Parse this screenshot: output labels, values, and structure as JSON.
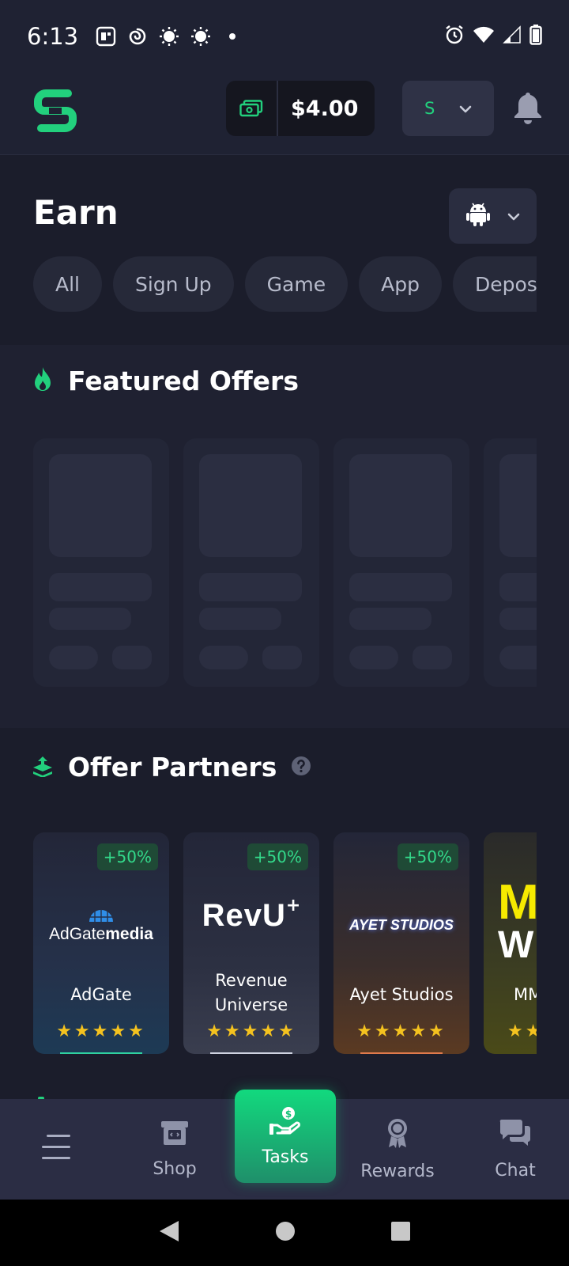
{
  "status_bar": {
    "time": "6:13"
  },
  "header": {
    "balance": "$4.00",
    "user_initial": "S"
  },
  "earn": {
    "title": "Earn",
    "filters": [
      "All",
      "Sign Up",
      "Game",
      "App",
      "Deposi"
    ]
  },
  "featured": {
    "title": "Featured Offers"
  },
  "partners": {
    "title": "Offer Partners",
    "items": [
      {
        "name": "AdGate",
        "badge": "+50%",
        "logo_text_a": "AdGate",
        "logo_text_b": "media",
        "rating": "★★★★★"
      },
      {
        "name": "Revenue Universe",
        "badge": "+50%",
        "logo_text": "RevU",
        "rating": "★★★★★"
      },
      {
        "name": "Ayet Studios",
        "badge": "+50%",
        "logo_text": "AYET STUDIOS",
        "rating": "★★★★★"
      },
      {
        "name": "MM",
        "badge": "",
        "logo_text_a": "M",
        "logo_text_b": "W",
        "rating": "★★"
      }
    ]
  },
  "bottom_nav": {
    "menu": "",
    "shop": "Shop",
    "tasks": "Tasks",
    "rewards": "Rewards",
    "chat": "Chat"
  },
  "colors": {
    "accent": "#22d07d",
    "background": "#1b1d2b",
    "star": "#f4c21f"
  },
  "icons": [
    "menu-icon",
    "shop-icon",
    "tasks-icon",
    "rewards-icon",
    "chat-icon",
    "bell-icon",
    "android-icon",
    "fire-icon",
    "stack-icon",
    "help-icon",
    "cash-icon"
  ]
}
